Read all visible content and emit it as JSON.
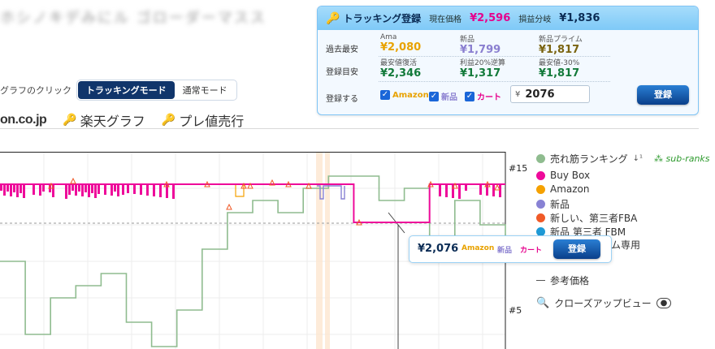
{
  "title_blurred": "ホシノキデみにル ゴローダーマスス",
  "mode": {
    "label": "グラフのクリック",
    "tracking_mode": "トラッキングモード",
    "normal_mode": "通常モード"
  },
  "sites": {
    "amazon": "on.co.jp",
    "rakuten": "楽天グラフ",
    "premium": "プレ値売行"
  },
  "panel": {
    "title": "トラッキング登録",
    "current_label": "現在価格",
    "current_value": "¥2,596",
    "breakeven_label": "損益分岐",
    "breakeven_value": "¥1,836",
    "rows": [
      {
        "label": "過去最安",
        "cells": [
          {
            "sub": "Ama",
            "value": "¥2,080"
          },
          {
            "sub": "新品",
            "value": "¥1,799"
          },
          {
            "sub": "新品プライム",
            "value": "¥1,817"
          }
        ]
      },
      {
        "label": "登録目安",
        "cells": [
          {
            "sub": "最安値復活",
            "value": "¥2,346"
          },
          {
            "sub": "利益20%逆算",
            "value": "¥1,317"
          },
          {
            "sub": "最安値-30%",
            "value": "¥1,817"
          }
        ]
      }
    ],
    "register_label": "登録する",
    "checks": {
      "amazon": "Amazon",
      "new": "新品",
      "cart": "カート"
    },
    "yen": "¥",
    "price_value": "2076",
    "submit": "登録"
  },
  "legend": {
    "items": [
      {
        "label": "売れ筋ランキング",
        "color": "#8fbc8f"
      },
      {
        "label": "Buy Box",
        "color": "#ee0a9a"
      },
      {
        "label": "Amazon",
        "color": "#f5a100"
      },
      {
        "label": "新品",
        "color": "#8882d4"
      },
      {
        "label": "新しい、第三者FBA",
        "color": "#f05a28"
      },
      {
        "label": "新品 第三者 FBM",
        "color": "#1e9ad6"
      },
      {
        "label": "ム専用",
        "color": "#ffffff"
      }
    ],
    "sub_ranks": "sub-ranks",
    "reference": "参考価格",
    "closeup": "クローズアップビュー"
  },
  "popup": {
    "price": "¥2,076",
    "amazon": "Amazon",
    "new": "新品",
    "cart": "カート",
    "submit": "登録"
  },
  "chart_data": {
    "type": "line",
    "yaxis_right_ticks": [
      "#15",
      "#5"
    ],
    "series": [
      {
        "name": "Buy Box",
        "color": "#ee0a9a",
        "values": [
          2596,
          2596,
          2596,
          2596,
          2596,
          2596,
          2596,
          2596,
          2596,
          2596,
          2596,
          2596,
          2596,
          2596,
          2076,
          2076,
          2076,
          2596,
          2596,
          2596,
          2596
        ]
      },
      {
        "name": "売れ筋ランキング",
        "color": "#8fbc8f",
        "values": [
          8,
          14,
          11,
          10,
          9,
          13,
          15,
          12,
          7,
          4,
          3,
          4,
          2,
          1,
          1,
          3,
          2,
          6,
          3,
          5,
          6
        ]
      }
    ]
  }
}
